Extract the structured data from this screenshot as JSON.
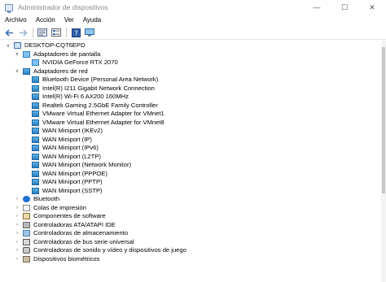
{
  "window": {
    "title": "Administrador de dispositivos",
    "minimize": "—",
    "maximize": "☐",
    "close": "✕"
  },
  "menu": [
    "Archivo",
    "Acción",
    "Ver",
    "Ayuda"
  ],
  "toolbar": [
    "back-arrow-icon",
    "forward-arrow-icon",
    "properties-icon",
    "view-icon",
    "help-icon",
    "monitor-icon"
  ],
  "tree": [
    {
      "level": 0,
      "toggle": "∨",
      "icon": "pc",
      "label": "DESKTOP-CQT6EPD"
    },
    {
      "level": 1,
      "toggle": "∨",
      "icon": "display",
      "label": "Adaptadores de pantalla"
    },
    {
      "level": 2,
      "toggle": "",
      "icon": "display",
      "label": "NVIDIA GeForce RTX 2070"
    },
    {
      "level": 1,
      "toggle": "∨",
      "icon": "net",
      "label": "Adaptadores de red"
    },
    {
      "level": 2,
      "toggle": "",
      "icon": "net",
      "label": "Bluetooth Device (Personal Area Network)"
    },
    {
      "level": 2,
      "toggle": "",
      "icon": "net",
      "label": "Intel(R) I211 Gigabit Network Connection"
    },
    {
      "level": 2,
      "toggle": "",
      "icon": "net",
      "label": "Intel(R) Wi-Fi 6 AX200 160MHz"
    },
    {
      "level": 2,
      "toggle": "",
      "icon": "net",
      "label": "Realtek Gaming 2.5GbE Family Controller"
    },
    {
      "level": 2,
      "toggle": "",
      "icon": "net",
      "label": "VMware Virtual Ethernet Adapter for VMnet1"
    },
    {
      "level": 2,
      "toggle": "",
      "icon": "net",
      "label": "VMware Virtual Ethernet Adapter for VMnet8"
    },
    {
      "level": 2,
      "toggle": "",
      "icon": "net",
      "label": "WAN Miniport (IKEv2)"
    },
    {
      "level": 2,
      "toggle": "",
      "icon": "net",
      "label": "WAN Miniport (IP)"
    },
    {
      "level": 2,
      "toggle": "",
      "icon": "net",
      "label": "WAN Miniport (IPv6)"
    },
    {
      "level": 2,
      "toggle": "",
      "icon": "net",
      "label": "WAN Miniport (L2TP)"
    },
    {
      "level": 2,
      "toggle": "",
      "icon": "net",
      "label": "WAN Miniport (Network Monitor)"
    },
    {
      "level": 2,
      "toggle": "",
      "icon": "net",
      "label": "WAN Miniport (PPPOE)"
    },
    {
      "level": 2,
      "toggle": "",
      "icon": "net",
      "label": "WAN Miniport (PPTP)"
    },
    {
      "level": 2,
      "toggle": "",
      "icon": "net",
      "label": "WAN Miniport (SSTP)"
    },
    {
      "level": 1,
      "toggle": "›",
      "icon": "bt",
      "label": "Bluetooth"
    },
    {
      "level": 1,
      "toggle": "›",
      "icon": "queue",
      "label": "Colas de impresión"
    },
    {
      "level": 1,
      "toggle": "›",
      "icon": "comp",
      "label": "Componentes de software"
    },
    {
      "level": 1,
      "toggle": "›",
      "icon": "ata",
      "label": "Controladoras ATA/ATAPI IDE"
    },
    {
      "level": 1,
      "toggle": "›",
      "icon": "storage",
      "label": "Controladoras de almacenamiento"
    },
    {
      "level": 1,
      "toggle": "›",
      "icon": "usb",
      "label": "Controladoras de bus serie universal"
    },
    {
      "level": 1,
      "toggle": "›",
      "icon": "sound",
      "label": "Controladoras de sonido y vídeo y dispositivos de juego"
    },
    {
      "level": 1,
      "toggle": "›",
      "icon": "bio",
      "label": "Dispositivos biométricos"
    }
  ]
}
